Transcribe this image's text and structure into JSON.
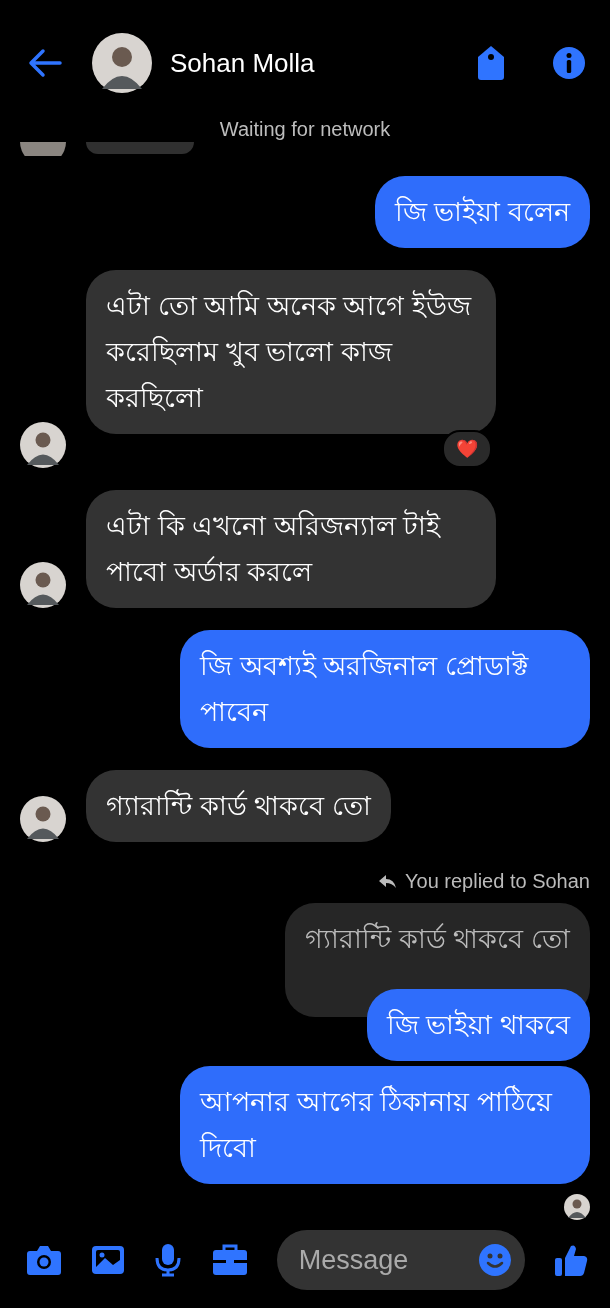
{
  "header": {
    "name": "Sohan Molla"
  },
  "status": "Waiting for network",
  "messages": [
    {
      "kind": "sent",
      "text": "জি ভাইয়া বলেন"
    },
    {
      "kind": "received",
      "text": "এটা তো আমি অনেক আগে ইউজ করেছিলাম খুব ভালো কাজ করছিলো",
      "reaction": "❤️"
    },
    {
      "kind": "received",
      "text": "এটা কি এখনো অরিজন্যাল টাই পাবো অর্ডার করলে"
    },
    {
      "kind": "sent",
      "text": "জি অবশ্যই অরজিনাল প্রোডাক্ট পাবেন"
    },
    {
      "kind": "received",
      "text": "গ্যারান্টি কার্ড থাকবে তো"
    },
    {
      "kind": "reply_label",
      "text": "You replied to Sohan"
    },
    {
      "kind": "quote",
      "text": "গ্যারান্টি কার্ড থাকবে তো"
    },
    {
      "kind": "sent",
      "text": "জি ভাইয়া থাকবে"
    },
    {
      "kind": "sent",
      "text": "আপনার আগের ঠিকানায় পাঠিয়ে দিবো"
    },
    {
      "kind": "seen"
    }
  ],
  "composer": {
    "placeholder": "Message"
  }
}
